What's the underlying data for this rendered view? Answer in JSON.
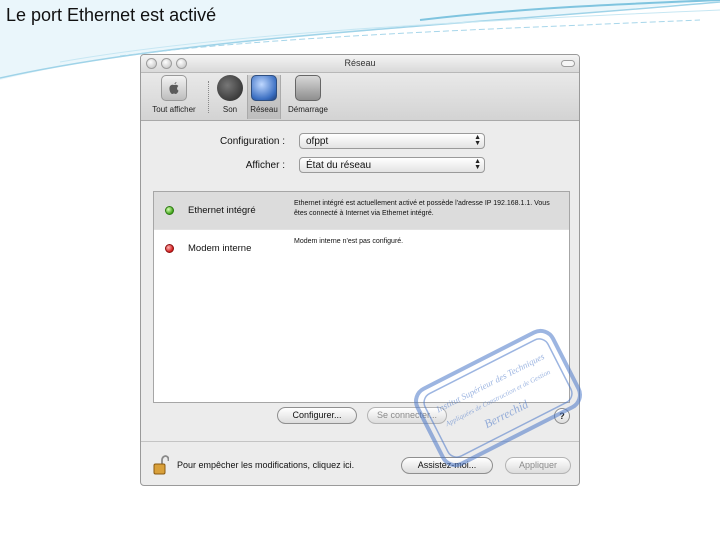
{
  "slide": {
    "title": "Le port Ethernet est activé"
  },
  "window": {
    "title": "Réseau"
  },
  "toolbar": {
    "items": [
      {
        "label": "Tout afficher",
        "icon": "apple-icon"
      },
      {
        "label": "Son",
        "icon": "speaker-icon"
      },
      {
        "label": "Réseau",
        "icon": "network-globe-icon",
        "selected": true
      },
      {
        "label": "Démarrage",
        "icon": "startup-disk-icon"
      }
    ]
  },
  "form": {
    "configuration_label": "Configuration :",
    "configuration_value": "ofppt",
    "show_label": "Afficher :",
    "show_value": "État du réseau"
  },
  "ports": [
    {
      "name": "Ethernet intégré",
      "status": "green",
      "description": "Ethernet intégré est actuellement activé et possède l'adresse IP 192.168.1.1. Vous êtes connecté à Internet via Ethernet intégré."
    },
    {
      "name": "Modem interne",
      "status": "red",
      "description": "Modem interne n'est pas configuré."
    }
  ],
  "buttons": {
    "configure": "Configurer...",
    "connect": "Se connecter...",
    "help": "?",
    "assist": "Assistez-moi...",
    "apply": "Appliquer"
  },
  "lock": {
    "text": "Pour empêcher les modifications, cliquez ici."
  },
  "stamp": {
    "line1": "Institut Supérieur des Techniques",
    "line2": "Appliquées de Construction et de Gestion",
    "line3": "Berrechid"
  }
}
